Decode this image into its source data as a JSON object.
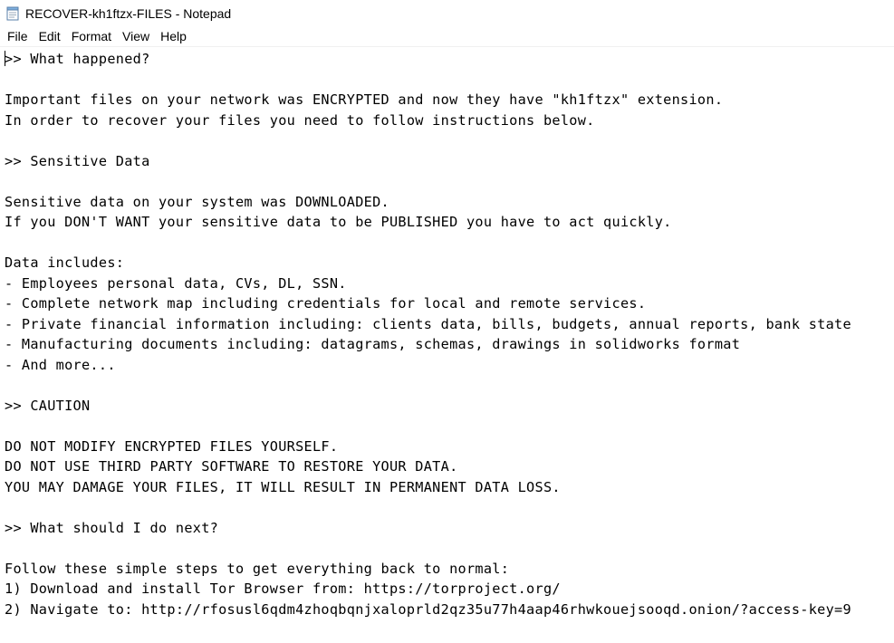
{
  "window": {
    "title": "RECOVER-kh1ftzx-FILES - Notepad",
    "icon": "notepad-icon"
  },
  "menu": {
    "items": [
      {
        "label": "File"
      },
      {
        "label": "Edit"
      },
      {
        "label": "Format"
      },
      {
        "label": "View"
      },
      {
        "label": "Help"
      }
    ]
  },
  "document": {
    "lines": [
      ">> What happened?",
      "",
      "Important files on your network was ENCRYPTED and now they have \"kh1ftzx\" extension.",
      "In order to recover your files you need to follow instructions below.",
      "",
      ">> Sensitive Data",
      "",
      "Sensitive data on your system was DOWNLOADED.",
      "If you DON'T WANT your sensitive data to be PUBLISHED you have to act quickly.",
      "",
      "Data includes:",
      "- Employees personal data, CVs, DL, SSN.",
      "- Complete network map including credentials for local and remote services.",
      "- Private financial information including: clients data, bills, budgets, annual reports, bank state",
      "- Manufacturing documents including: datagrams, schemas, drawings in solidworks format",
      "- And more...",
      "",
      ">> CAUTION",
      "",
      "DO NOT MODIFY ENCRYPTED FILES YOURSELF.",
      "DO NOT USE THIRD PARTY SOFTWARE TO RESTORE YOUR DATA.",
      "YOU MAY DAMAGE YOUR FILES, IT WILL RESULT IN PERMANENT DATA LOSS.",
      "",
      ">> What should I do next?",
      "",
      "Follow these simple steps to get everything back to normal:",
      "1) Download and install Tor Browser from: https://torproject.org/",
      "2) Navigate to: http://rfosusl6qdm4zhoqbqnjxaloprld2qz35u77h4aap46rhwkouejsooqd.onion/?access-key=9"
    ]
  }
}
